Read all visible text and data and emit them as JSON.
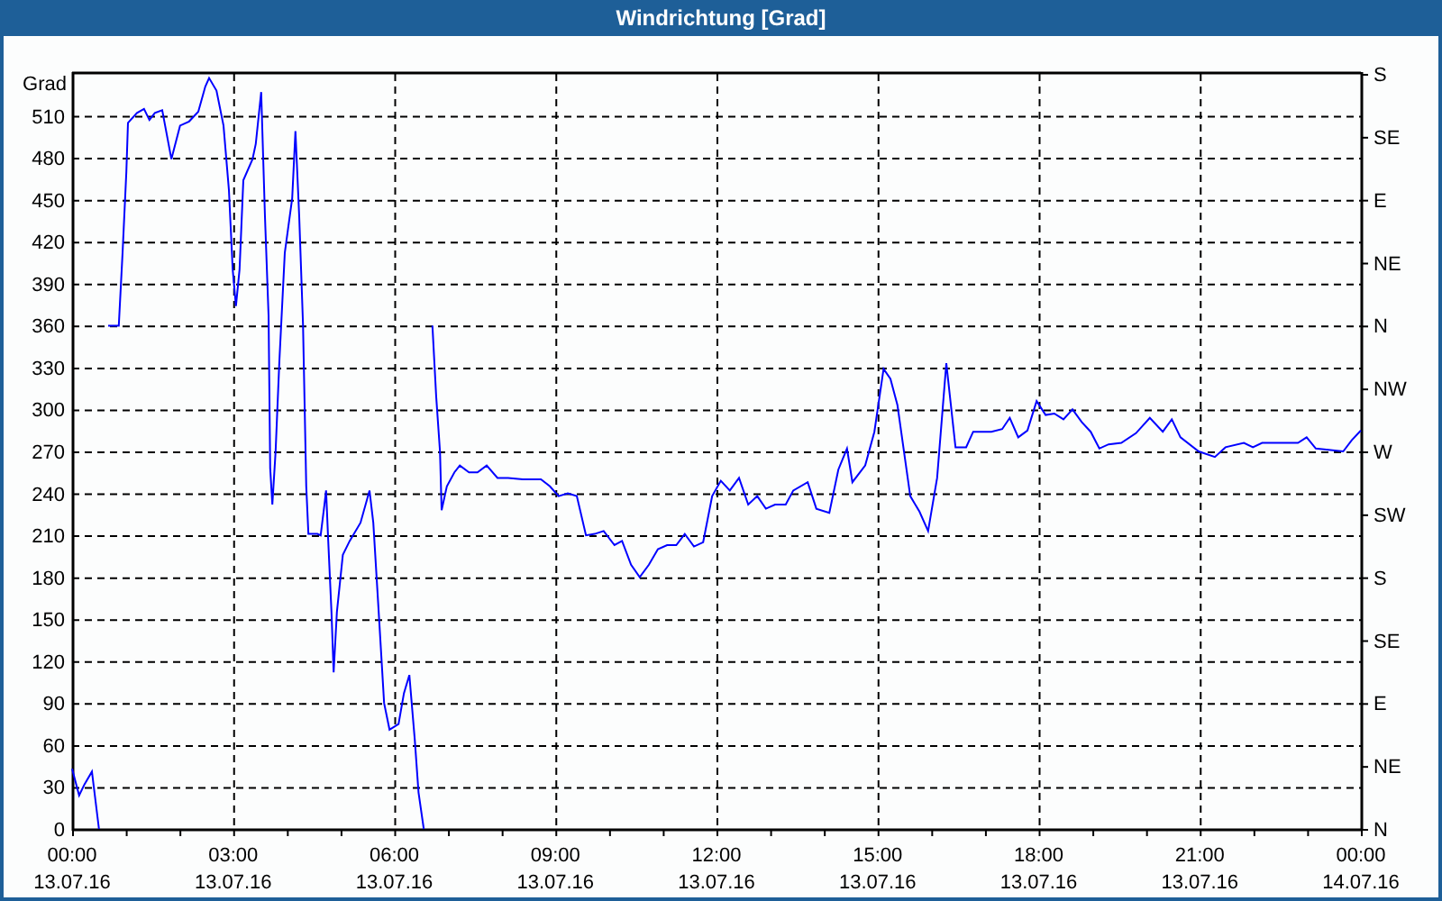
{
  "window": {
    "title": "Windrichtung [Grad]"
  },
  "chart_data": {
    "type": "line",
    "ylabel": "Grad",
    "xlim": [
      0,
      24
    ],
    "ylim": [
      0,
      540
    ],
    "xticks": [
      {
        "value": 0,
        "label": "00:00"
      },
      {
        "value": 3,
        "label": "03:00"
      },
      {
        "value": 6,
        "label": "06:00"
      },
      {
        "value": 9,
        "label": "09:00"
      },
      {
        "value": 12,
        "label": "12:00"
      },
      {
        "value": 15,
        "label": "15:00"
      },
      {
        "value": 18,
        "label": "18:00"
      },
      {
        "value": 21,
        "label": "21:00"
      },
      {
        "value": 24,
        "label": "00:00"
      }
    ],
    "grid": true,
    "yticks": [
      0,
      30,
      60,
      90,
      120,
      150,
      180,
      210,
      240,
      270,
      300,
      330,
      360,
      390,
      420,
      450,
      480,
      510
    ],
    "x": [
      0,
      0.13,
      0.23,
      0.37,
      0.5,
      0.55,
      0.67,
      0.87,
      0.94,
      1.01,
      1.04,
      1.21,
      1.34,
      1.44,
      1.54,
      1.68,
      1.85,
      2.01,
      2.18,
      2.35,
      2.48,
      2.55,
      2.69,
      2.82,
      2.92,
      2.99,
      3.05,
      3.12,
      3.19,
      3.36,
      3.42,
      3.52,
      3.59,
      3.66,
      3.69,
      3.73,
      3.79,
      3.86,
      3.96,
      4.1,
      4.16,
      4.23,
      4.3,
      4.36,
      4.4,
      4.57,
      4.63,
      4.7,
      4.73,
      4.77,
      4.83,
      4.87,
      4.93,
      5.04,
      5.17,
      5.37,
      5.54,
      5.61,
      5.71,
      5.81,
      5.91,
      6.08,
      6.18,
      6.28,
      6.38,
      6.45,
      6.55,
      6.6,
      6.71,
      6.78,
      6.85,
      6.88,
      6.98,
      7.12,
      7.22,
      7.39,
      7.55,
      7.72,
      7.92,
      8.12,
      8.39,
      8.73,
      8.9,
      9.06,
      9.23,
      9.4,
      9.57,
      9.73,
      9.9,
      10.1,
      10.24,
      10.41,
      10.57,
      10.74,
      10.91,
      11.08,
      11.25,
      11.41,
      11.58,
      11.75,
      11.92,
      12.08,
      12.25,
      12.42,
      12.59,
      12.76,
      12.92,
      13.09,
      13.29,
      13.43,
      13.7,
      13.86,
      14.1,
      14.27,
      14.43,
      14.53,
      14.77,
      14.94,
      15.11,
      15.24,
      15.37,
      15.61,
      15.78,
      15.94,
      16.11,
      16.28,
      16.45,
      16.65,
      16.78,
      16.95,
      17.12,
      17.32,
      17.46,
      17.62,
      17.79,
      17.96,
      18.13,
      18.29,
      18.46,
      18.63,
      18.8,
      18.97,
      19.13,
      19.3,
      19.54,
      19.81,
      20.07,
      20.31,
      20.48,
      20.64,
      20.98,
      21.28,
      21.48,
      21.82,
      21.99,
      22.16,
      22.83,
      22.99,
      23.16,
      23.67,
      23.83,
      24
    ],
    "series": [
      {
        "color": "#0000ff",
        "values": [
          43,
          24,
          32,
          41,
          0,
          null,
          360,
          360,
          412,
          470,
          505,
          512,
          515,
          507,
          512,
          514,
          479,
          503,
          506,
          513,
          531,
          537,
          528,
          503,
          457,
          400,
          374,
          400,
          464,
          479,
          490,
          527,
          438,
          367,
          258,
          232,
          270,
          335,
          412,
          451,
          499,
          438,
          361,
          245,
          211,
          211,
          210,
          232,
          242,
          206,
          155,
          112,
          155,
          196,
          206,
          219,
          242,
          219,
          155,
          90,
          71,
          75,
          97,
          110,
          64,
          26,
          0,
          null,
          360,
          309,
          270,
          228,
          245,
          255,
          260,
          255,
          255,
          260,
          251,
          251,
          250,
          250,
          245,
          238,
          240,
          238,
          210,
          211,
          213,
          203,
          206,
          189,
          180,
          189,
          200,
          203,
          203,
          211,
          202,
          205,
          238,
          249,
          242,
          251,
          232,
          238,
          229,
          232,
          232,
          242,
          248,
          229,
          226,
          257,
          272,
          248,
          260,
          284,
          329,
          322,
          303,
          238,
          227,
          213,
          251,
          333,
          273,
          273,
          284,
          284,
          284,
          286,
          294,
          280,
          285,
          306,
          296,
          297,
          293,
          300,
          291,
          284,
          272,
          275,
          276,
          283,
          294,
          284,
          293,
          280,
          270,
          266,
          273,
          276,
          273,
          276,
          276,
          280,
          272,
          270,
          278,
          285
        ]
      }
    ]
  },
  "x_axis_dates": [
    "13.07.16",
    "13.07.16",
    "13.07.16",
    "13.07.16",
    "13.07.16",
    "13.07.16",
    "13.07.16",
    "13.07.16",
    "14.07.16"
  ],
  "direction_axis": {
    "labels": [
      "S",
      "SE",
      "E",
      "NE",
      "N",
      "NW",
      "W",
      "SW",
      "S",
      "SE",
      "E",
      "NE",
      "N"
    ]
  }
}
